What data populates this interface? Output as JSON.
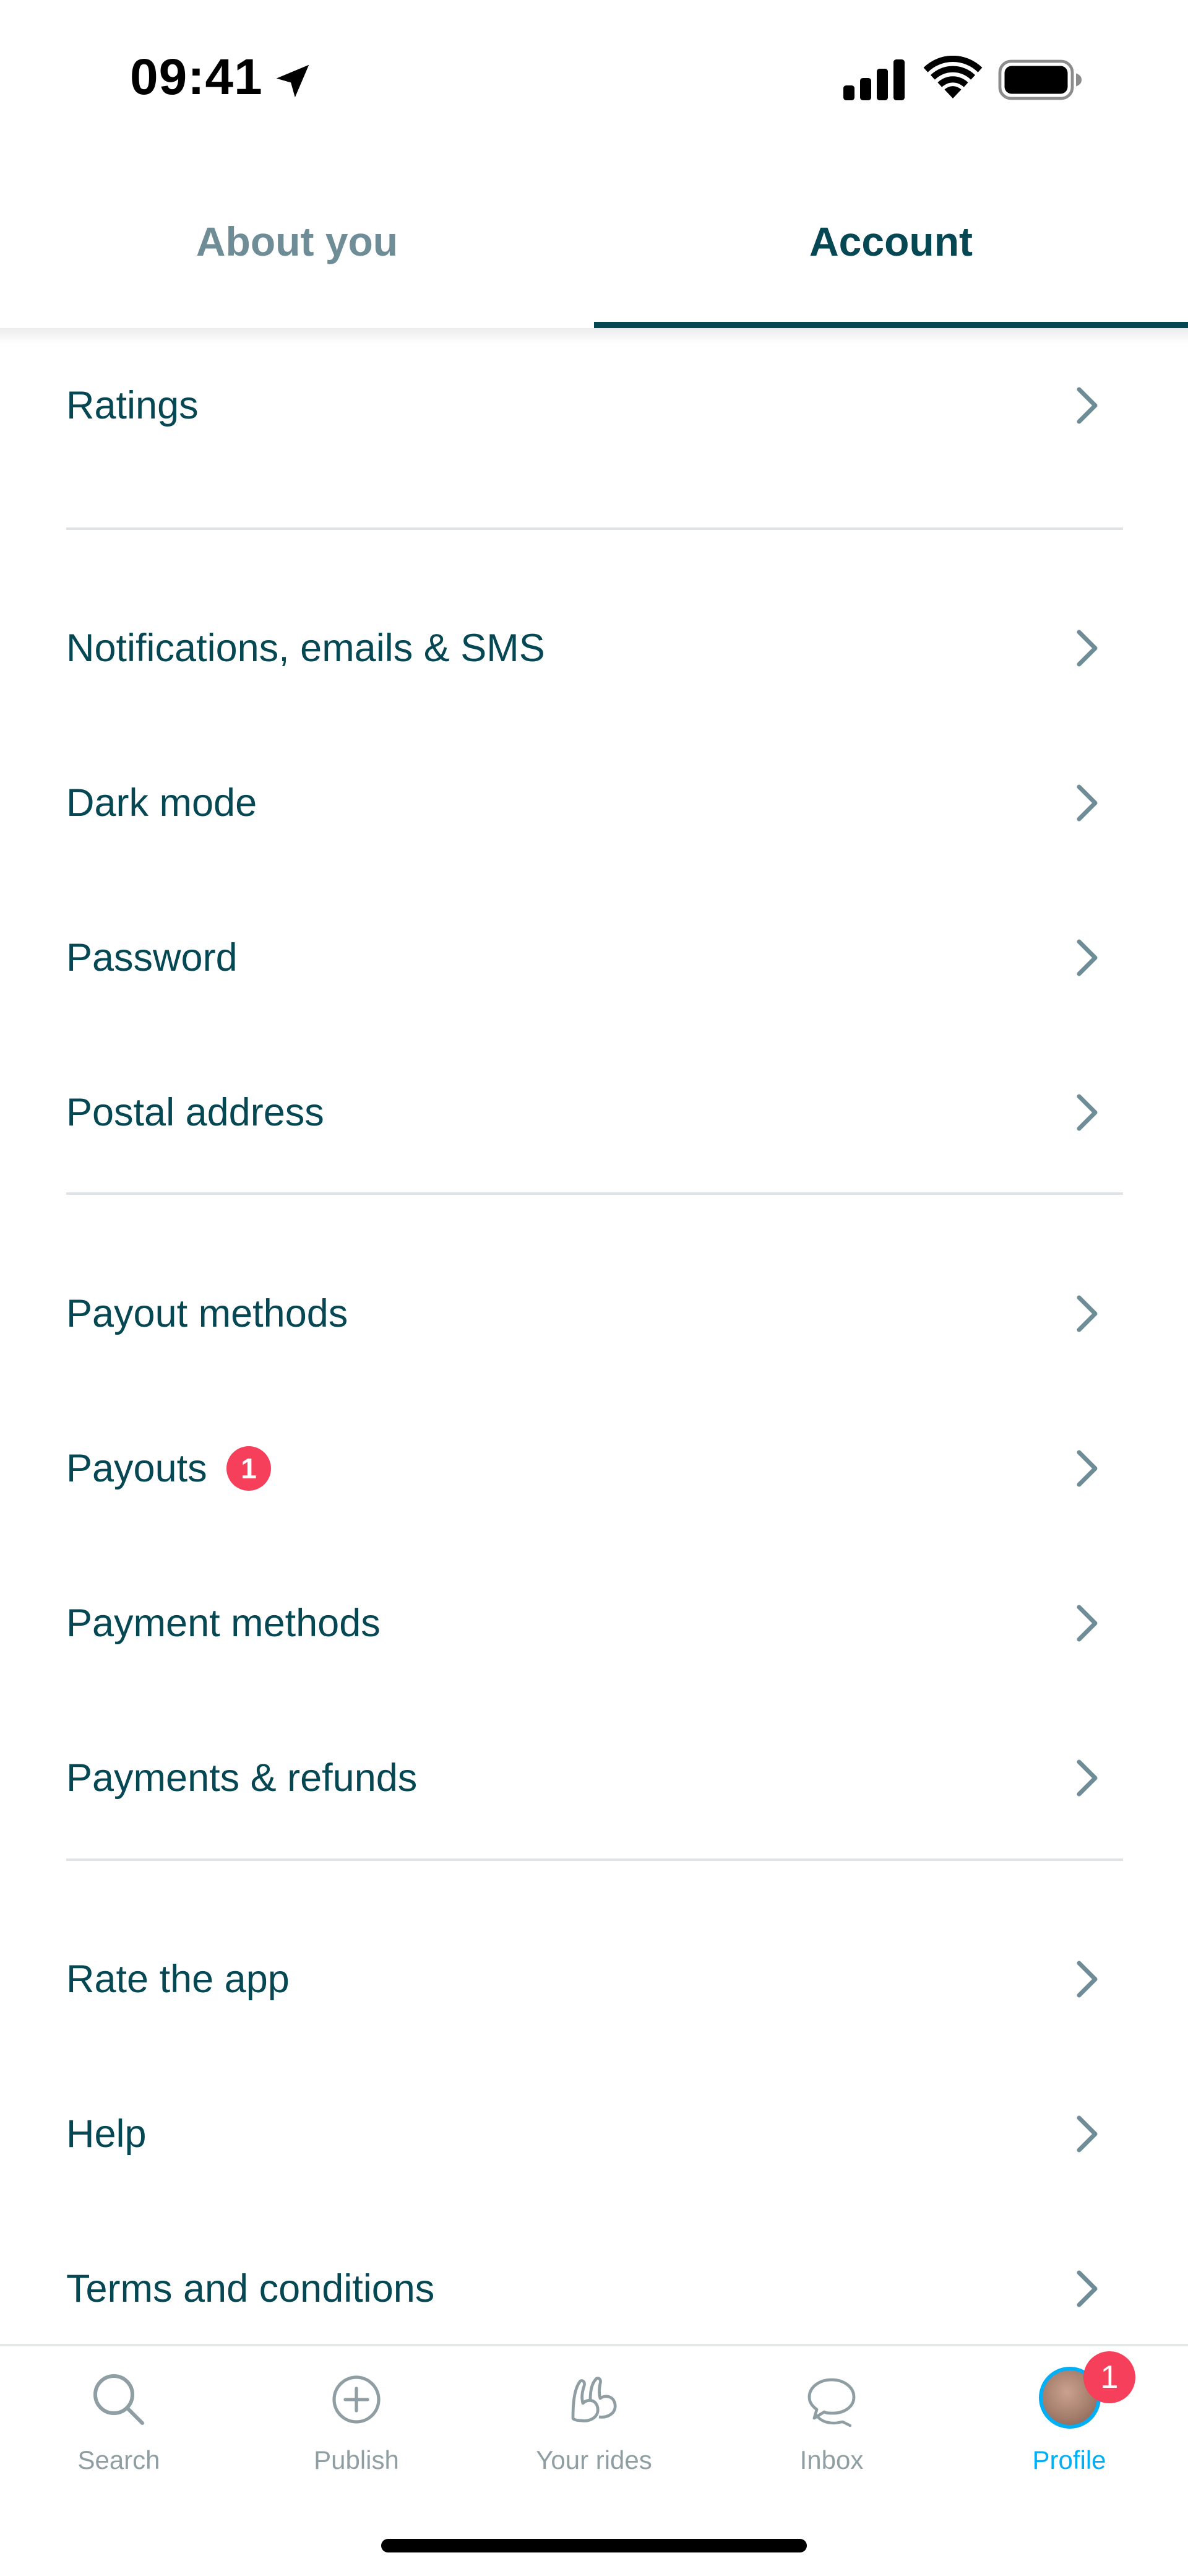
{
  "status_bar": {
    "time": "09:41",
    "icons": [
      "location-arrow-icon",
      "cellular-signal-icon",
      "wifi-icon",
      "battery-icon"
    ]
  },
  "tabs": [
    {
      "label": "About you",
      "active": false
    },
    {
      "label": "Account",
      "active": true
    }
  ],
  "menu": {
    "ratings": "Ratings",
    "notifications": "Notifications, emails & SMS",
    "dark_mode": "Dark mode",
    "password": "Password",
    "postal_address": "Postal address",
    "payout_methods": "Payout methods",
    "payouts": "Payouts",
    "payouts_badge": "1",
    "payment_methods": "Payment methods",
    "payments_refunds": "Payments & refunds",
    "rate_app": "Rate the app",
    "help": "Help",
    "terms": "Terms and conditions"
  },
  "bottom_nav": {
    "search": "Search",
    "publish": "Publish",
    "your_rides": "Your rides",
    "inbox": "Inbox",
    "profile": "Profile",
    "profile_badge": "1",
    "active": "Profile"
  },
  "colors": {
    "primary_text": "#054752",
    "secondary_text": "#6f8d96",
    "accent": "#00aff5",
    "badge": "#f53f5b"
  }
}
